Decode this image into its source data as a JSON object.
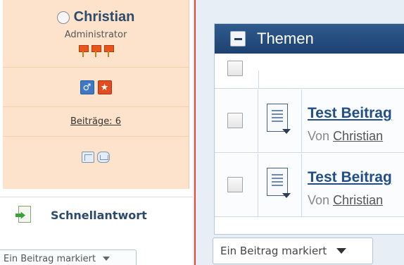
{
  "profile": {
    "username": "Christian",
    "rank": "Administrator",
    "posts_label": "Beiträge: 6",
    "gender_icon": "male-icon",
    "rank_icon": "star-icon"
  },
  "quickreply": {
    "label": "Schnellantwort"
  },
  "moderation": {
    "left_select_value": "Ein Beitrag markiert",
    "right_select_value": "Ein Beitrag markiert"
  },
  "topics_panel": {
    "title": "Themen",
    "rows": [
      {
        "title": "Test Beitrag",
        "by_prefix": "Von",
        "author": "Christian"
      },
      {
        "title": "Test Beitrag",
        "by_prefix": "Von",
        "author": "Christian"
      }
    ]
  },
  "colors": {
    "profile_bg": "#fde3cb",
    "header_bg": "#1e4170",
    "divider": "#e8443a",
    "link": "#1f4f86"
  }
}
